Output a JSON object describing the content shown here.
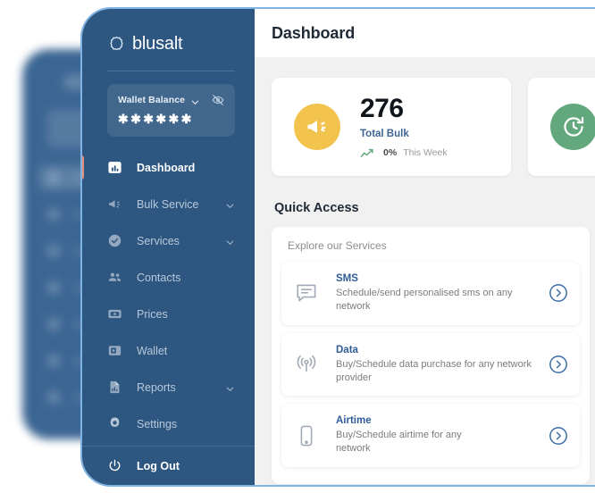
{
  "brand": {
    "name": "blusalt",
    "logo_icon": "gear-circle-icon"
  },
  "wallet": {
    "label": "Wallet Balance",
    "masked_value": "✱✱✱✱✱✱",
    "chevron_icon": "chevron-down-icon",
    "visibility_icon": "eye-off-icon"
  },
  "sidebar": {
    "items": [
      {
        "label": "Dashboard",
        "icon": "chart-bar-icon",
        "active": true,
        "has_chevron": false
      },
      {
        "label": "Bulk Service",
        "icon": "megaphone-icon",
        "active": false,
        "has_chevron": true
      },
      {
        "label": "Services",
        "icon": "check-circle-icon",
        "active": false,
        "has_chevron": true
      },
      {
        "label": "Contacts",
        "icon": "people-icon",
        "active": false,
        "has_chevron": false
      },
      {
        "label": "Prices",
        "icon": "banknote-icon",
        "active": false,
        "has_chevron": false
      },
      {
        "label": "Wallet",
        "icon": "wallet-icon",
        "active": false,
        "has_chevron": false
      },
      {
        "label": "Reports",
        "icon": "report-file-icon",
        "active": false,
        "has_chevron": true
      },
      {
        "label": "Settings",
        "icon": "gear-icon",
        "active": false,
        "has_chevron": false
      }
    ],
    "logout": {
      "label": "Log Out",
      "icon": "power-icon"
    }
  },
  "header": {
    "title": "Dashboard"
  },
  "stats": [
    {
      "value": "276",
      "label": "Total Bulk",
      "percent": "0%",
      "period": "This Week",
      "icon": "megaphone-icon",
      "icon_color": "#F2C44D",
      "trend_icon": "trend-up-icon",
      "trend_color": "#5EA87A"
    },
    {
      "value": "",
      "label": "",
      "percent": "",
      "period": "",
      "icon": "clock-refresh-icon",
      "icon_color": "#62A87C",
      "trend_icon": "",
      "trend_color": ""
    }
  ],
  "quick_access": {
    "title": "Quick Access",
    "card_heading": "Explore our Services",
    "services": [
      {
        "name": "SMS",
        "description": "Schedule/send personalised sms on any network",
        "icon": "chat-bubble-icon",
        "go_icon": "chevron-right-circle-icon"
      },
      {
        "name": "Data",
        "description": "Buy/Schedule data purchase for any network provider",
        "icon": "signal-wave-icon",
        "go_icon": "chevron-right-circle-icon"
      },
      {
        "name": "Airtime",
        "description": "Buy/Schedule airtime for any network",
        "icon": "mobile-phone-icon",
        "go_icon": "chevron-right-circle-icon"
      }
    ]
  },
  "colors": {
    "sidebar_bg": "#2d5680",
    "content_bg": "#f1f1f1",
    "accent_active": "#e98d76",
    "link_blue": "#2f5c96",
    "window_border": "#7fb3e3"
  }
}
